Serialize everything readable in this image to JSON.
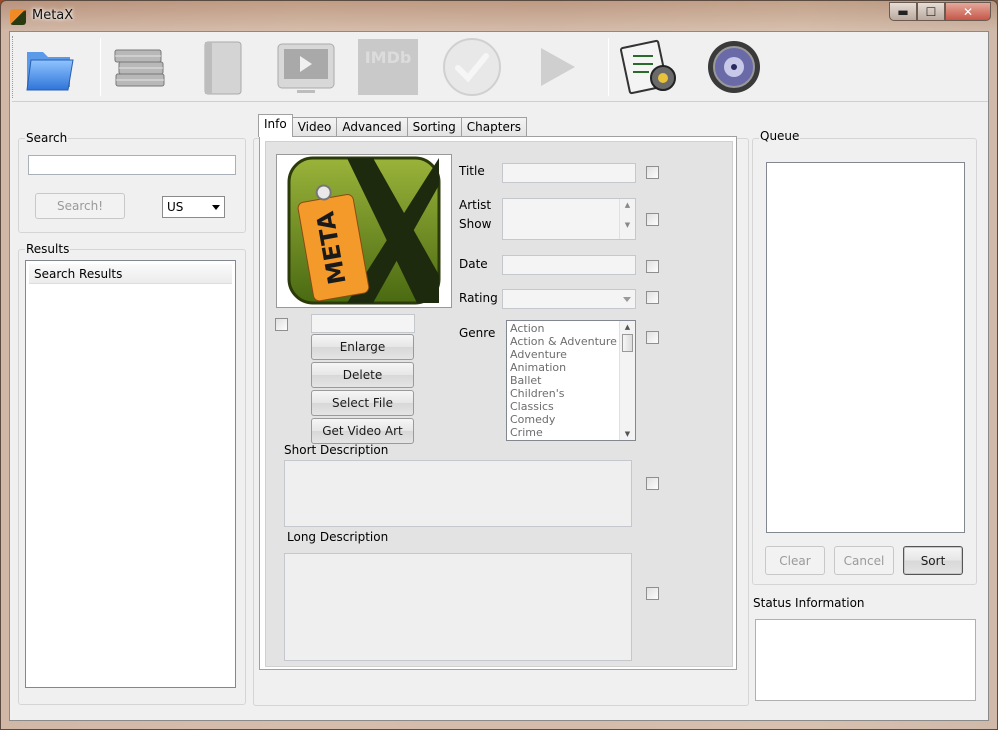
{
  "window": {
    "title": "MetaX",
    "minimize": "▬",
    "maximize": "☐",
    "close": "✕"
  },
  "toolbar": {
    "buttons": [
      {
        "icon": "open-folder-icon"
      },
      {
        "icon": "books-stack-icon"
      },
      {
        "icon": "book-icon"
      },
      {
        "icon": "tv-icon"
      },
      {
        "icon": "imdb-icon",
        "label": "IMDb"
      },
      {
        "icon": "checkmark-icon"
      },
      {
        "icon": "play-arrow-icon"
      },
      {
        "icon": "settings-icon"
      },
      {
        "icon": "about-icon"
      }
    ]
  },
  "search": {
    "group_label": "Search",
    "input_value": "",
    "button_label": "Search!",
    "region_selected": "US"
  },
  "results": {
    "group_label": "Results",
    "column_header": "Search Results"
  },
  "tabs": [
    {
      "label": "Info",
      "active": true
    },
    {
      "label": "Video",
      "active": false
    },
    {
      "label": "Advanced",
      "active": false
    },
    {
      "label": "Sorting",
      "active": false
    },
    {
      "label": "Chapters",
      "active": false
    }
  ],
  "info": {
    "artwork_alt": "META X",
    "artwork_text": "META",
    "artwork_path": "",
    "buttons": {
      "enlarge": "Enlarge",
      "delete": "Delete",
      "select_file": "Select File",
      "get_video_art": "Get Video Art"
    },
    "fields": {
      "title_label": "Title",
      "title_value": "",
      "artist_label": "Artist",
      "show_label": "Show",
      "artist_value": "",
      "date_label": "Date",
      "date_value": "",
      "rating_label": "Rating",
      "rating_value": "",
      "genre_label": "Genre"
    },
    "genres": [
      "Action",
      "Action & Adventure",
      "Adventure",
      "Animation",
      "Ballet",
      "Children's",
      "Classics",
      "Comedy",
      "Crime"
    ],
    "short_description_label": "Short Description",
    "short_description_value": "",
    "long_description_label": "Long Description",
    "long_description_value": ""
  },
  "queue": {
    "group_label": "Queue",
    "clear": "Clear",
    "cancel": "Cancel",
    "sort": "Sort"
  },
  "status": {
    "label": "Status Information",
    "text": ""
  },
  "colors": {
    "client_bg": "#f0f0f0",
    "tab_bg": "#e3e3e3",
    "artwork_orange": "#f08a24",
    "artwork_green": "#5a7a1a"
  }
}
